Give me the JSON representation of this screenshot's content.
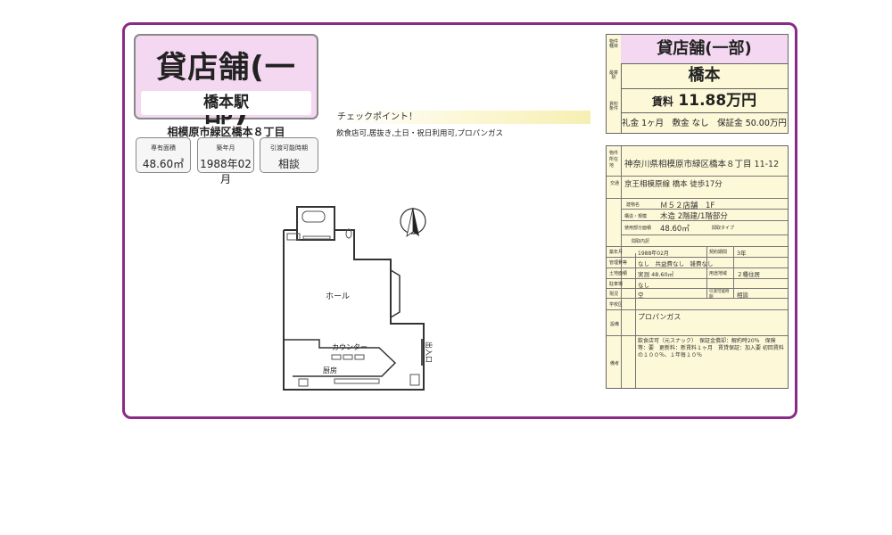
{
  "header": {
    "title": "貸店舗(一部)",
    "station": "橋本駅",
    "address": "相模原市緑区橋本８丁目"
  },
  "summary": {
    "area_label": "専有面積",
    "area_value": "48.60㎡",
    "built_label": "築年月",
    "built_value": "1988年02月",
    "handover_label": "引渡可能時期",
    "handover_value": "相談"
  },
  "checkpoint": {
    "title": "チェックポイント！",
    "text": "飲食店可,居抜き,土日・祝日利用可,プロパンガス"
  },
  "right_header": {
    "side_labels": [
      "物件種目",
      "最寄駅",
      "賃料条件"
    ],
    "type": "貸店舗(一部)",
    "station": "橋本",
    "rent_label": "賃料",
    "rent_value": "11.88万円",
    "conditions": "礼金 1ヶ月　敷金 なし　保証金 50.00万円"
  },
  "details": {
    "location_label": "物件所在地",
    "location": "神奈川県相模原市緑区橋本８丁目 11-12",
    "traffic_label": "交通",
    "traffic": "京王相模原線 橋本 徒歩17分",
    "building_label": "建物名",
    "building": "Ｍ５２店舗　1F",
    "structure_label": "構造・規模",
    "structure": "木造 2階建/1階部分",
    "area_label": "使用部分面積",
    "area": "48.60㎡",
    "layout_label": "間取タイプ",
    "layout_detail_label": "間取内訳",
    "built_label": "築年月",
    "built": "1988年02月",
    "contract_label": "契約期間",
    "contract": "3年",
    "fees_label": "管理費等",
    "fees": "なし　共益費なし　雑費なし",
    "land_label": "土地面積",
    "land": "実測 48.60㎡",
    "zoning_label": "用途地域",
    "zoning": "２種住居",
    "parking_label": "駐車場",
    "parking": "なし",
    "status_label": "現況",
    "status": "空",
    "handover_label": "引渡可能時期",
    "handover": "相談",
    "school_label": "学校区",
    "equipment_label": "設備",
    "equipment": "プロパンガス",
    "notes_label": "備考",
    "notes": "飲食店可（元スナック）　保証金償却：解約時20％　保険等：要　更新料：新賃料１ヶ月　賃貸保証：加入要 初回賃料の１００％、１年毎１０％"
  },
  "floorplan": {
    "hall": "ホール",
    "counter": "カウンター",
    "kitchen": "厨房",
    "entrance": "出入口"
  }
}
